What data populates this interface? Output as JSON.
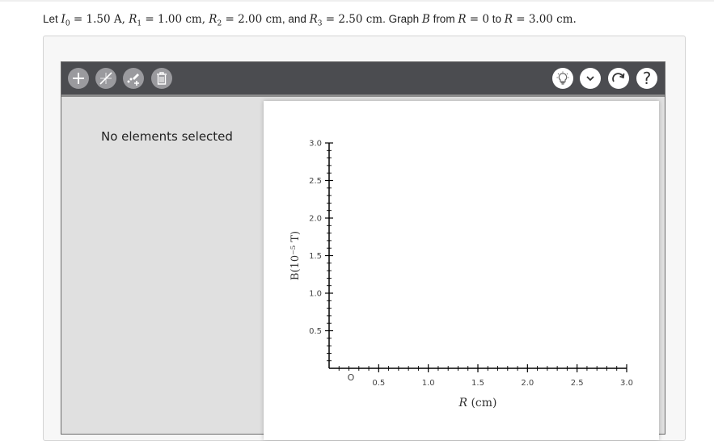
{
  "problem": {
    "prefix": "Let ",
    "i0_sym": "I",
    "i0_sub": "0",
    "i0_val": " = 1.50 A, ",
    "r1_sym": "R",
    "r1_sub": "1",
    "r1_val": " = 1.00 cm, ",
    "r2_sym": "R",
    "r2_sub": "2",
    "r2_val": " = 2.00 cm",
    "and": ", and ",
    "r3_sym": "R",
    "r3_sub": "3",
    "r3_val": " = 2.50 cm",
    "graph_text": ". Graph ",
    "b_sym": "B",
    "from_text": " from ",
    "r_sym_a": "R",
    "from_val": " = 0",
    "to_text": " to ",
    "r_sym_b": "R",
    "to_val": " = 3.00 cm."
  },
  "toolbar": {
    "left_tools": [
      "add-icon",
      "line-tool-icon",
      "point-tool-icon",
      "trash-icon"
    ],
    "right_tools": [
      "hint-lightbulb-icon",
      "chevron-down-icon",
      "redo-icon",
      "help-icon"
    ],
    "help_label": "?",
    "dim_color": "#9a9a9e",
    "bar_color": "#4b4c50"
  },
  "panel": {
    "empty_message": "No elements selected"
  },
  "chart_data": {
    "type": "line",
    "series": [],
    "xlabel_var": "R",
    "xlabel_unit": " (cm)",
    "ylabel": "B(10⁻⁵ T)",
    "xlim": [
      0,
      3.0
    ],
    "ylim": [
      0,
      3.0
    ],
    "x_ticks": [
      "O",
      "0.5",
      "1.0",
      "1.5",
      "2.0",
      "2.5",
      "3.0"
    ],
    "x_tick_values": [
      0,
      0.5,
      1.0,
      1.5,
      2.0,
      2.5,
      3.0
    ],
    "y_ticks": [
      "0.5",
      "1.0",
      "1.5",
      "2.0",
      "2.5",
      "3.0"
    ],
    "y_tick_values": [
      0.5,
      1.0,
      1.5,
      2.0,
      2.5,
      3.0
    ],
    "minor_per_major": 5,
    "grid": false
  }
}
